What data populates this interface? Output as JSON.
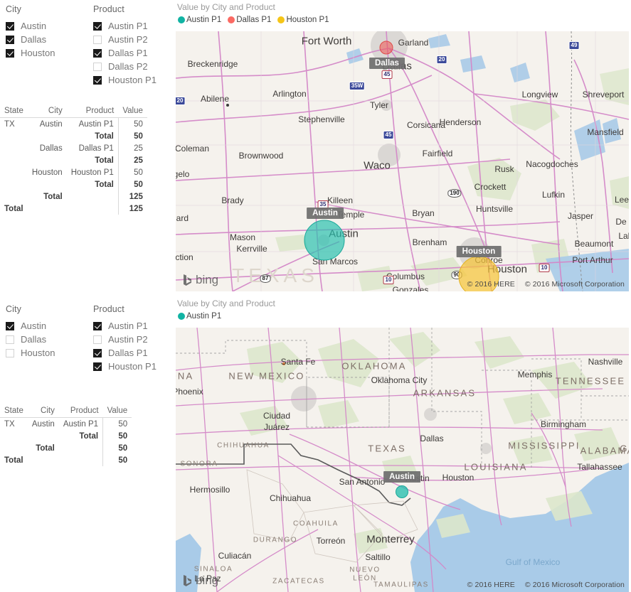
{
  "slicer_panels": [
    {
      "id": "top",
      "city": {
        "title": "City",
        "items": [
          {
            "label": "Austin",
            "checked": true
          },
          {
            "label": "Dallas",
            "checked": true
          },
          {
            "label": "Houston",
            "checked": true
          }
        ]
      },
      "product": {
        "title": "Product",
        "items": [
          {
            "label": "Austin P1",
            "checked": true
          },
          {
            "label": "Austin P2",
            "checked": false
          },
          {
            "label": "Dallas P1",
            "checked": true
          },
          {
            "label": "Dallas P2",
            "checked": false
          },
          {
            "label": "Houston P1",
            "checked": true
          }
        ]
      }
    },
    {
      "id": "bottom",
      "city": {
        "title": "City",
        "items": [
          {
            "label": "Austin",
            "checked": true
          },
          {
            "label": "Dallas",
            "checked": false
          },
          {
            "label": "Houston",
            "checked": false
          }
        ]
      },
      "product": {
        "title": "Product",
        "items": [
          {
            "label": "Austin P1",
            "checked": true
          },
          {
            "label": "Austin P2",
            "checked": false
          },
          {
            "label": "Dallas P1",
            "checked": true
          },
          {
            "label": "Houston P1",
            "checked": true
          }
        ]
      }
    }
  ],
  "tables": [
    {
      "id": "top",
      "columns": [
        "State",
        "City",
        "Product",
        "Value"
      ],
      "rows": [
        {
          "state": "TX",
          "city": "Austin",
          "product": "Austin P1",
          "value": "50",
          "bold": false
        },
        {
          "state": "",
          "city": "",
          "product": "Total",
          "value": "50",
          "bold": true
        },
        {
          "state": "",
          "city": "Dallas",
          "product": "Dallas P1",
          "value": "25",
          "bold": false
        },
        {
          "state": "",
          "city": "",
          "product": "Total",
          "value": "25",
          "bold": true
        },
        {
          "state": "",
          "city": "Houston",
          "product": "Houston P1",
          "value": "50",
          "bold": false
        },
        {
          "state": "",
          "city": "",
          "product": "Total",
          "value": "50",
          "bold": true
        },
        {
          "state": "",
          "city": "Total",
          "product": "",
          "value": "125",
          "bold": true
        },
        {
          "state": "Total",
          "city": "",
          "product": "",
          "value": "125",
          "bold": true
        }
      ]
    },
    {
      "id": "bottom",
      "columns": [
        "State",
        "City",
        "Product",
        "Value"
      ],
      "rows": [
        {
          "state": "TX",
          "city": "Austin",
          "product": "Austin P1",
          "value": "50",
          "bold": false
        },
        {
          "state": "",
          "city": "",
          "product": "Total",
          "value": "50",
          "bold": true
        },
        {
          "state": "",
          "city": "Total",
          "product": "",
          "value": "50",
          "bold": true
        },
        {
          "state": "Total",
          "city": "",
          "product": "",
          "value": "50",
          "bold": true
        }
      ]
    }
  ],
  "maps": [
    {
      "id": "map-top",
      "title": "Value by City and Product",
      "legend": [
        {
          "label": "Austin P1",
          "color": "#11b3a3"
        },
        {
          "label": "Dallas P1",
          "color": "#fb6a63"
        },
        {
          "label": "Houston P1",
          "color": "#f5c518"
        }
      ],
      "bubbles": [
        {
          "city": "Austin",
          "color": "#25bfae",
          "value": 50,
          "radius": 28
        },
        {
          "city": "Dallas",
          "color": "#ef5350",
          "value": 25,
          "radius": 8
        },
        {
          "city": "Houston",
          "color": "#f6c53a",
          "value": 50,
          "radius": 28
        }
      ],
      "pins": [
        "Dallas",
        "Austin",
        "Houston"
      ],
      "attribution": [
        "© 2016 HERE",
        "© 2016 Microsoft Corporation"
      ],
      "provider": "bing",
      "watermark": "TEXAS",
      "labels": [
        "Breckenridge",
        "Fort Worth",
        "Garland",
        "Dallas",
        "Abilene",
        "Arlington",
        "Longview",
        "Shreveport",
        "Stephenville",
        "Corsicana",
        "Tyler",
        "Henderson",
        "Mansfield",
        "Coleman",
        "Brownwood",
        "Waco",
        "Fairfield",
        "Rusk",
        "Nacogdoches",
        "gelo",
        "Crockett",
        "Lufkin",
        "Lees",
        "Brady",
        "Killeen",
        "Temple",
        "Jasper",
        "De R",
        "nard",
        "Mason",
        "Bryan",
        "Huntsville",
        "ction",
        "Conroe",
        "Kerrville",
        "Brenham",
        "Beaumont",
        "Lak",
        "San Marcos",
        "Columbus",
        "Houston",
        "Port Arthur",
        "Gonzales",
        "Austin"
      ]
    },
    {
      "id": "map-bottom",
      "title": "Value by City and Product",
      "legend": [
        {
          "label": "Austin P1",
          "color": "#11b3a3"
        }
      ],
      "bubbles": [
        {
          "city": "Austin",
          "color": "#25bfae",
          "value": 50,
          "radius": 8
        }
      ],
      "pins": [
        "Austin"
      ],
      "attribution": [
        "© 2016 HERE",
        "© 2016 Microsoft Corporation"
      ],
      "provider": "bing",
      "watermark": "Gulf of Mexico",
      "labels": [
        "Santa Fe",
        "OKLAHOMA",
        "Nashville",
        "Memphis",
        "TENNESSEE",
        "Oklahoma City",
        "ARKANSAS",
        "NEW MEXICO",
        "ONA",
        "Phoenix",
        "Ciudad",
        "Juárez",
        "Dallas",
        "TEXAS",
        "MISSISSIPPI",
        "ALABAMA",
        "GE",
        "Birmingham",
        "Tallahassee",
        "CHIHUAHUA",
        "SONORA",
        "LOUISIANA",
        "Austin",
        "Houston",
        "San Antonio",
        "Hermosillo",
        "Chihuahua",
        "COAHUILA",
        "DURANGO",
        "Torreón",
        "Monterrey",
        "Saltillo",
        "Culiacán",
        "SINALOA",
        "NUEVO",
        "LEÓN",
        "ZACATECAS",
        "TAMAULIPAS",
        "La Paz",
        "Gulf of Mexico"
      ]
    }
  ]
}
